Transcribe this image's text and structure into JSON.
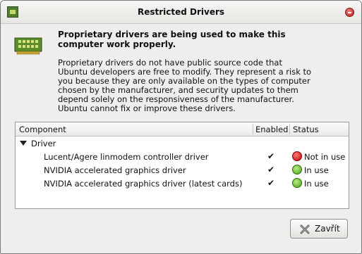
{
  "window": {
    "title": "Restricted Drivers"
  },
  "header": {
    "headline": "Proprietary drivers are being used to make this computer work properly.",
    "description": "Proprietary drivers do not have public source code that Ubuntu developers are free to modify. They represent a risk to you because they are only available on the types of computer chosen by the manufacturer, and security updates to them depend solely on the responsiveness of the manufacturer. Ubuntu cannot fix or improve these drivers."
  },
  "table": {
    "columns": {
      "component": "Component",
      "enabled": "Enabled",
      "status": "Status"
    },
    "group": "Driver",
    "rows": [
      {
        "name": "Lucent/Agere linmodem controller driver",
        "enabled": true,
        "status": "Not in use",
        "status_color": "#cc0000"
      },
      {
        "name": "NVIDIA accelerated graphics driver",
        "enabled": true,
        "status": "In use",
        "status_color": "#4ea01c"
      },
      {
        "name": "NVIDIA accelerated graphics driver (latest cards)",
        "enabled": true,
        "status": "In use",
        "status_color": "#4ea01c"
      }
    ]
  },
  "buttons": {
    "close_label": "Zavřít"
  },
  "icons": {
    "title": "driver-card-icon",
    "header": "pci-card-icon",
    "close": "close-x-icon"
  }
}
